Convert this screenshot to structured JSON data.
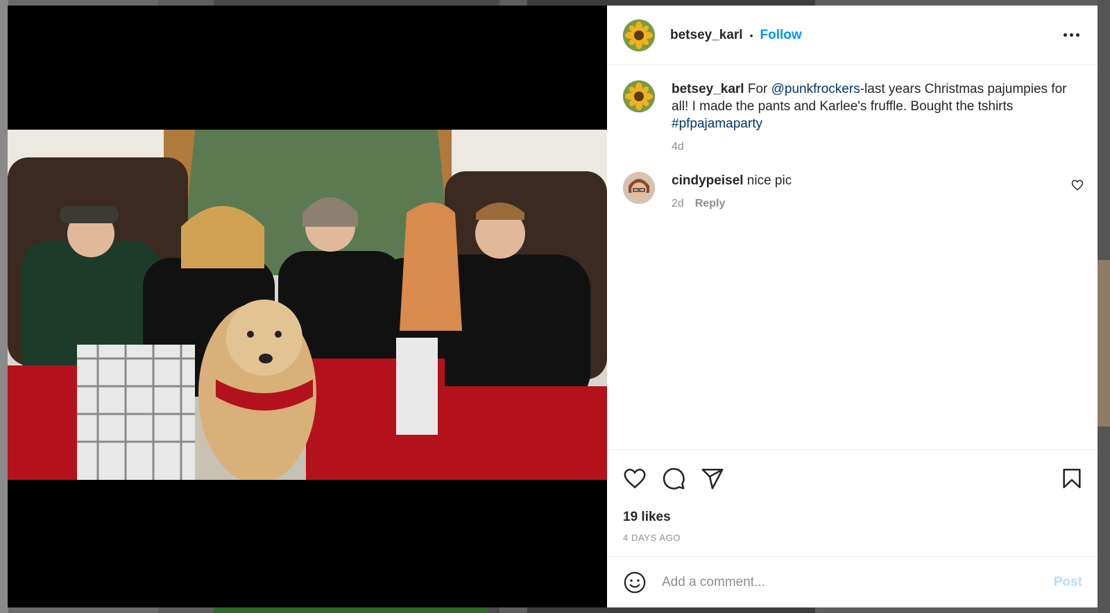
{
  "post": {
    "author": "betsey_karl",
    "follow_label": "Follow",
    "separator": "•",
    "likes": "19 likes",
    "date": "4 DAYS AGO"
  },
  "caption": {
    "username": "betsey_karl",
    "text_before": "For ",
    "mention": "@punkfrockers",
    "text_middle": "-last years Christmas pajumpies for all! I made the pants and Karlee's fruffle. Bought the tshirts ",
    "hashtag": "#pfpajamaparty",
    "time": "4d"
  },
  "comments": [
    {
      "username": "cindypeisel",
      "text": "nice pic",
      "time": "2d",
      "reply_label": "Reply"
    }
  ],
  "composer": {
    "placeholder": "Add a comment...",
    "post_label": "Post"
  },
  "colors": {
    "accent": "#0095f6",
    "mention": "#00376b",
    "post_disabled": "#b2dffc"
  },
  "icons": [
    "more-icon",
    "like-icon",
    "comment-icon",
    "share-icon",
    "save-icon",
    "emoji-icon",
    "comment-like-icon"
  ]
}
